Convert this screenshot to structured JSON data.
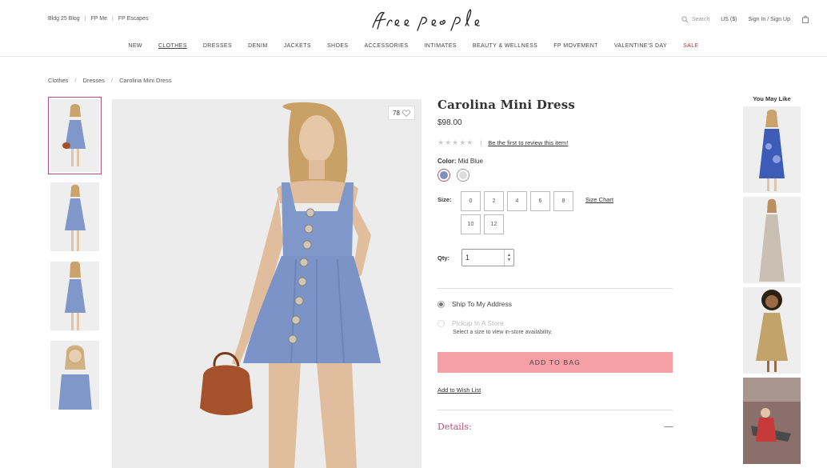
{
  "top_links": [
    "Bldg 25 Blog",
    "FP Me",
    "FP Escapes"
  ],
  "logo": "free people",
  "utility": {
    "search_placeholder": "Search",
    "currency": "US ($)",
    "sign_in": "Sign In / Sign Up"
  },
  "nav": [
    "NEW",
    "CLOTHES",
    "DRESSES",
    "DENIM",
    "JACKETS",
    "SHOES",
    "ACCESSORIES",
    "INTIMATES",
    "BEAUTY & WELLNESS",
    "FP MOVEMENT",
    "VALENTINE'S DAY",
    "SALE"
  ],
  "breadcrumb": [
    "Clothes",
    "Dresses",
    "Carolina Mini Dress"
  ],
  "product": {
    "title": "Carolina Mini Dress",
    "price": "$98.00",
    "likes": "78",
    "review_prompt": "Be the first to review this item!",
    "color_label": "Color:",
    "color_value": "Mid Blue",
    "size_label": "Size:",
    "sizes": [
      "0",
      "2",
      "4",
      "6",
      "8",
      "10",
      "12"
    ],
    "size_chart": "Size Chart",
    "qty_label": "Qty:",
    "qty_value": "1",
    "ship_option": "Ship To My Address",
    "pickup_option": "Pickup In A Store",
    "pickup_note": "Select a size to view in-store availability.",
    "add_to_bag": "ADD TO BAG",
    "wish_list": "Add to Wish List",
    "details": "Details:"
  },
  "you_may_like": "You May Like",
  "colors": {
    "accent": "#b4527c",
    "add_to_bag_bg": "#f4a0a4",
    "sale": "#cc3333",
    "swatch_blue": "#7f8fbf",
    "swatch_grey": "#dedede"
  }
}
